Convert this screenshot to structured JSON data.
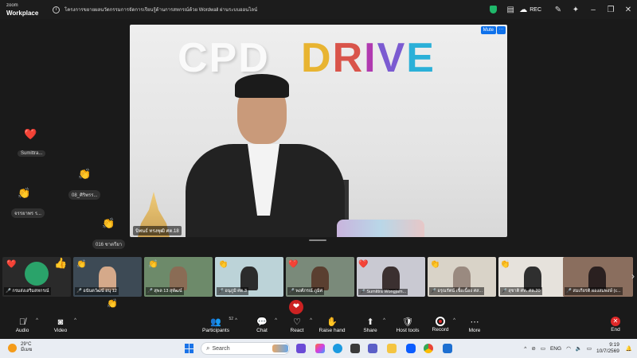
{
  "app": {
    "logo_line1": "zoom",
    "logo_line2": "Workplace"
  },
  "meeting": {
    "title": "โครงการขยายผลนวัตกรรมการจัดการเรียนรู้ด้านการสหกรณ์ด้วย Wordwall ผ่านระบบออนไลน์",
    "rec_label": "REC"
  },
  "main_video": {
    "name": "นิพนธ์ ทรงพุฒิ ศต.18",
    "mute_label": "Mute",
    "more_label": "···",
    "backdrop_left": "CPD",
    "backdrop_right": [
      "D",
      "R",
      "I",
      "V",
      "E"
    ]
  },
  "floating": [
    {
      "label": "Sumittra..."
    },
    {
      "label": "08_ศิริพรร..."
    },
    {
      "label": "จรรยาพร ร..."
    },
    {
      "label": "016 ชาตรียา"
    }
  ],
  "participants": [
    {
      "name": "กรมส่งเสริมสหกรณ์"
    },
    {
      "name": "อนันตวัฒน์ อนุ 12"
    },
    {
      "name": "สุพล 13 สุพัฒน์"
    },
    {
      "name": "อนุภูมิ ศต.3"
    },
    {
      "name": "พงศ์ภรณ์ ภูมิศ"
    },
    {
      "name": "Sumittra Wongjam..."
    },
    {
      "name": "อรุณรัตน์ เชื้อเนื้อง ศส..."
    },
    {
      "name": "สุชาติ ศท. ศต.20"
    },
    {
      "name": "สมเกียรติ ผองสมพงษ์ (c..."
    }
  ],
  "toolbar": {
    "audio": "Audio",
    "video": "Video",
    "participants": "Participants",
    "participants_count": "52",
    "chat": "Chat",
    "react": "React",
    "raise_hand": "Raise hand",
    "share": "Share",
    "host_tools": "Host tools",
    "record": "Record",
    "more": "More",
    "end": "End"
  },
  "taskbar": {
    "temp": "29°C",
    "weather": "มีเมฆ",
    "search": "Search",
    "lang": "ENG",
    "time": "9:19",
    "date": "10/7/2569"
  },
  "colors": {
    "zoom_blue": "#0e71eb",
    "end_red": "#e02828",
    "drive_d": "#e8b431",
    "drive_r": "#d9544a",
    "drive_i": "#b03ab0",
    "drive_v": "#7b5bd1",
    "drive_e": "#2bb0d8"
  },
  "icons": [
    "info-icon",
    "shield-icon",
    "cloud-icon",
    "mic-icon",
    "video-icon",
    "participants-icon",
    "chat-icon",
    "react-icon",
    "raise-hand-icon",
    "share-icon",
    "host-tools-icon",
    "record-icon",
    "more-icon",
    "end-icon",
    "windows-icon",
    "search-icon",
    "sun-icon",
    "wifi-icon",
    "volume-icon",
    "battery-icon"
  ]
}
